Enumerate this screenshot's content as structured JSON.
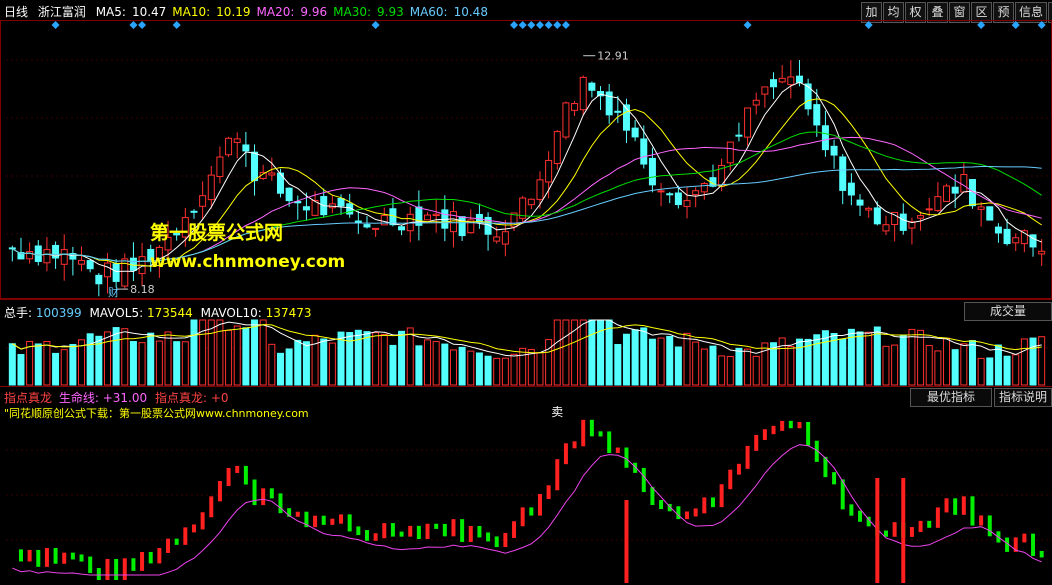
{
  "header": {
    "period": "日线",
    "stock": "浙江富润",
    "ma": [
      {
        "label": "MA5:",
        "value": "10.47",
        "color": "#ffffff"
      },
      {
        "label": "MA10:",
        "value": "10.19",
        "color": "#ffff00"
      },
      {
        "label": "MA20:",
        "value": "9.96",
        "color": "#ff66ff"
      },
      {
        "label": "MA30:",
        "value": "9.93",
        "color": "#00dd00"
      },
      {
        "label": "MA60:",
        "value": "10.48",
        "color": "#66ccff"
      }
    ],
    "toolbar": [
      "加",
      "均",
      "权",
      "叠",
      "窗",
      "区",
      "预",
      "信息"
    ]
  },
  "watermark": {
    "title": "第一股票公式网",
    "url": "www.chnmoney.com"
  },
  "price_annotations": {
    "high": "12.91",
    "low": "8.18",
    "marker": "财"
  },
  "volume": {
    "label": "总手:",
    "value": "100399",
    "mavol5_label": "MAVOL5:",
    "mavol5": "173544",
    "mavol10_label": "MAVOL10:",
    "mavol10": "137473",
    "button": "成交量"
  },
  "indicator": {
    "name": "指点真龙",
    "line_label": "生命线:",
    "line_value": "+31.00",
    "name2": "指点真龙:",
    "value2": "+0",
    "source_text": "\"同花顺原创公式下载：第一股票公式网www.chnmoney.com",
    "sell_label": "卖",
    "btn_best": "最优指标",
    "btn_help": "指标说明"
  },
  "colors": {
    "up": "#ff3030",
    "down": "#54ffff",
    "ma5": "#ffffff",
    "ma10": "#ffff00",
    "ma20": "#ff66ff",
    "ma30": "#00dd00",
    "ma60": "#66ccff",
    "ind_up": "#ff2020",
    "ind_down": "#00ee00",
    "life": "#ee44ee"
  },
  "chart_data": [
    {
      "type": "candlestick",
      "name": "price",
      "ylim": [
        8.0,
        13.4
      ],
      "high_value": 12.91,
      "low_value": 8.18,
      "bars": 120
    },
    {
      "type": "bar",
      "name": "volume",
      "series": [
        "总手",
        "MAVOL5",
        "MAVOL10"
      ]
    },
    {
      "type": "bar",
      "name": "indicator",
      "series": [
        "指点真龙",
        "生命线"
      ]
    }
  ]
}
